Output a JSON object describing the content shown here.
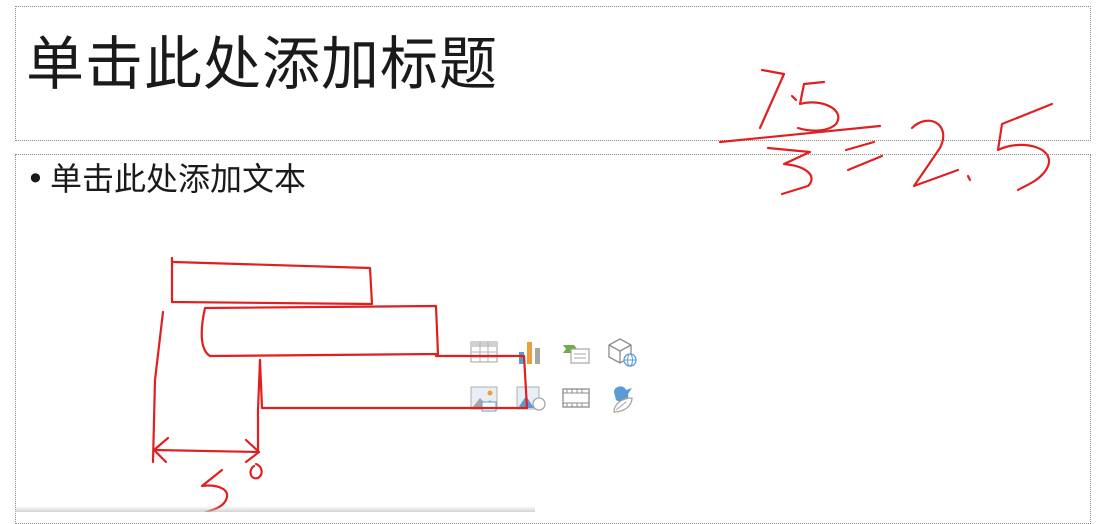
{
  "slide": {
    "title_placeholder": "单击此处添加标题",
    "content_placeholder": "单击此处添加文本",
    "bullet_glyph": "•"
  },
  "insert_icons": [
    {
      "name": "insert-table-icon",
      "label": "table"
    },
    {
      "name": "insert-chart-icon",
      "label": "chart"
    },
    {
      "name": "insert-smartart-icon",
      "label": "smartart"
    },
    {
      "name": "insert-3d-model-icon",
      "label": "3d-model"
    },
    {
      "name": "insert-picture-icon",
      "label": "picture"
    },
    {
      "name": "insert-online-picture-icon",
      "label": "online-picture"
    },
    {
      "name": "insert-video-icon",
      "label": "video"
    },
    {
      "name": "insert-icons-icon",
      "label": "icons"
    }
  ],
  "ink": {
    "color": "#e02020",
    "annotations": [
      "7.5",
      "3",
      "2.5",
      "5"
    ]
  },
  "colors": {
    "icon_gray": "#a6a6a6",
    "icon_blue": "#5b9bd5",
    "icon_orange": "#ed9f3a",
    "icon_green": "#70ad47"
  }
}
